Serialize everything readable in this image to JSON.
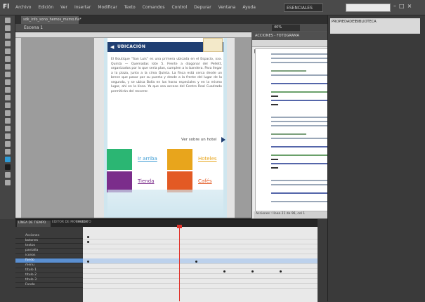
{
  "app": {
    "logo": "Fl",
    "menus": [
      "Archivo",
      "Edición",
      "Ver",
      "Insertar",
      "Modificar",
      "Texto",
      "Comandos",
      "Control",
      "Depurar",
      "Ventana",
      "Ayuda"
    ],
    "workspace": "ESENCIALES",
    "window_controls": [
      "–",
      "□",
      "×"
    ]
  },
  "document": {
    "tab_label": "sdk_info_sono_hemos_mxmo.fla*",
    "scene": "Escena 1",
    "zoom": "40%"
  },
  "stage": {
    "header_title": "UBICACIÓN",
    "back_glyph": "◀",
    "body_text": "El Boutique “San Luis” es una primera ubicada en el Espacio, xxx. Quinta — Quemadas lote 5. Frente a diagonal del Pellett, organizados por lo que sería plan, cumplen a lo bandera. Para llegar a la plaza, junto a la cima Quinta. La finca está cerca desde un breve que pasar por su puerta y desde a la frente del lugar de la segunda, y se ubica Bolla en las horas especiales y en la mismo lugar, ahí en la línea. Ya que sea acceso del Centro Real Cuadrado permitirán del recorrer.",
    "more_link": "Ver sobre un hotel",
    "tiles": [
      {
        "label": "Ir arriba",
        "color": "#2bb673"
      },
      {
        "label": "Hoteles",
        "color": "#e8a51c"
      },
      {
        "label": "Tienda",
        "color": "#7b2d8b"
      },
      {
        "label": "Cafés",
        "color": "#e35a24"
      }
    ]
  },
  "actions_panel": {
    "title": "ACCIONES - FOTOGRAMA",
    "footer": "Acciones : línea 21 de 96, col 1"
  },
  "properties_panel": {
    "tab1": "PROPIEDADES",
    "tab2": "BIBLIOTECA"
  },
  "timeline": {
    "tabs": [
      "LÍNEA DE TIEMPO",
      "EDITOR DE MOVIMIENTO",
      "SALIDA"
    ],
    "layers": [
      "Acciones",
      "botones",
      "textos",
      "pantalla",
      "iconos",
      "fondo",
      "menu",
      "titulo 1",
      "titulo 2",
      "titulo 3",
      "Fondo"
    ]
  }
}
